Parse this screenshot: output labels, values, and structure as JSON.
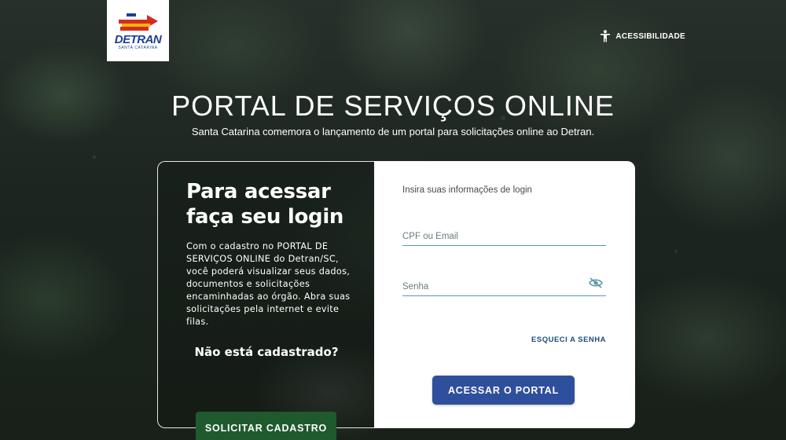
{
  "logo": {
    "word": "DETRAN",
    "sub": "SANTA CATARINA",
    "colors": {
      "blue": "#1c3f94",
      "red": "#d52b1e",
      "yellow": "#f2b705"
    }
  },
  "accessibility": {
    "label": "ACESSIBILIDADE",
    "icon": "accessibility-icon"
  },
  "hero": {
    "title": "PORTAL DE SERVIÇOS ONLINE",
    "subtitle": "Santa Catarina comemora o lançamento de um portal para solicitações online ao Detran."
  },
  "left_panel": {
    "title_line1": "Para acessar",
    "title_line2": "faça seu login",
    "description": "Com o cadastro no PORTAL DE SERVIÇOS ONLINE do Detran/SC, você poderá visualizar seus dados, documentos e solicitações encaminhadas ao órgão. Abra suas solicitações pela internet e evite filas.",
    "question": "Não está cadastrado?",
    "register_label": "SOLICITAR CADASTRO"
  },
  "login": {
    "prompt": "Insira suas informações de login",
    "cpf_placeholder": "CPF ou Email",
    "password_placeholder": "Senha",
    "password_toggle_icon": "eye-off-icon",
    "forgot_label": "ESQUECI A SENHA",
    "submit_label": "ACESSAR O PORTAL"
  },
  "colors": {
    "login_button": "#2e4f9c",
    "register_button": "#1f5a2e",
    "field_underline": "#5a9aa6",
    "link": "#1d4e7d"
  }
}
